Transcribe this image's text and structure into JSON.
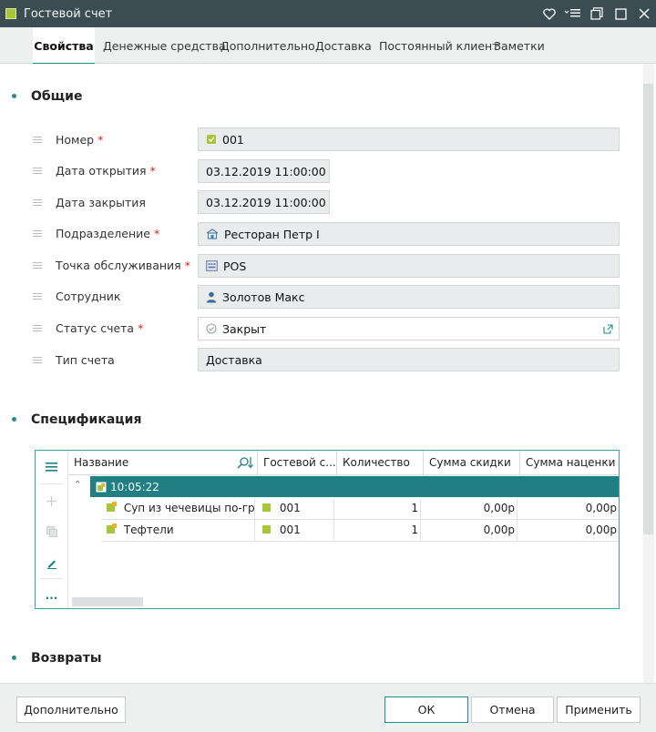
{
  "window": {
    "title": "Гостевой счет"
  },
  "tabs": [
    {
      "label": "Свойства"
    },
    {
      "label": "Денежные средства"
    },
    {
      "label": "Дополнительно"
    },
    {
      "label": "Доставка"
    },
    {
      "label": "Постоянный клиент"
    },
    {
      "label": "Заметки"
    }
  ],
  "sections": {
    "general": "Общие",
    "spec": "Спецификация",
    "returns": "Возвраты"
  },
  "fields": {
    "number": {
      "label": "Номер",
      "value": "001",
      "required": "*"
    },
    "open_date": {
      "label": "Дата открытия",
      "value": "03.12.2019 11:00:00",
      "required": "*"
    },
    "close_date": {
      "label": "Дата закрытия",
      "value": "03.12.2019 11:00:00"
    },
    "division": {
      "label": "Подразделение",
      "value": "Ресторан Петр I",
      "required": "*"
    },
    "service_point": {
      "label": "Точка обслуживания",
      "value": "POS",
      "required": "*"
    },
    "employee": {
      "label": "Сотрудник",
      "value": "Золотов Макс"
    },
    "status": {
      "label": "Статус счета",
      "value": "Закрыт",
      "required": "*"
    },
    "type": {
      "label": "Тип счета",
      "value": "Доставка"
    }
  },
  "grid": {
    "columns": [
      "Название",
      "Гостевой с...",
      "Количество",
      "Сумма скидки",
      "Сумма наценки"
    ],
    "group": {
      "label": "10:05:22"
    },
    "rows": [
      {
        "name": "Суп из чечевицы по-греч...",
        "check": "001",
        "qty": "1",
        "discount": "0,00р",
        "markup": "0,00р"
      },
      {
        "name": "Тефтели",
        "check": "001",
        "qty": "1",
        "discount": "0,00р",
        "markup": "0,00р"
      }
    ],
    "side_more": "..."
  },
  "footer": {
    "more": "Дополнительно",
    "ok": "ОК",
    "cancel": "Отмена",
    "apply": "Применить"
  },
  "colors": {
    "accent": "#1f8e8c",
    "titlebar": "#3b4d52",
    "group_row": "#1f7f82",
    "brand_green": "#a8c63a"
  }
}
